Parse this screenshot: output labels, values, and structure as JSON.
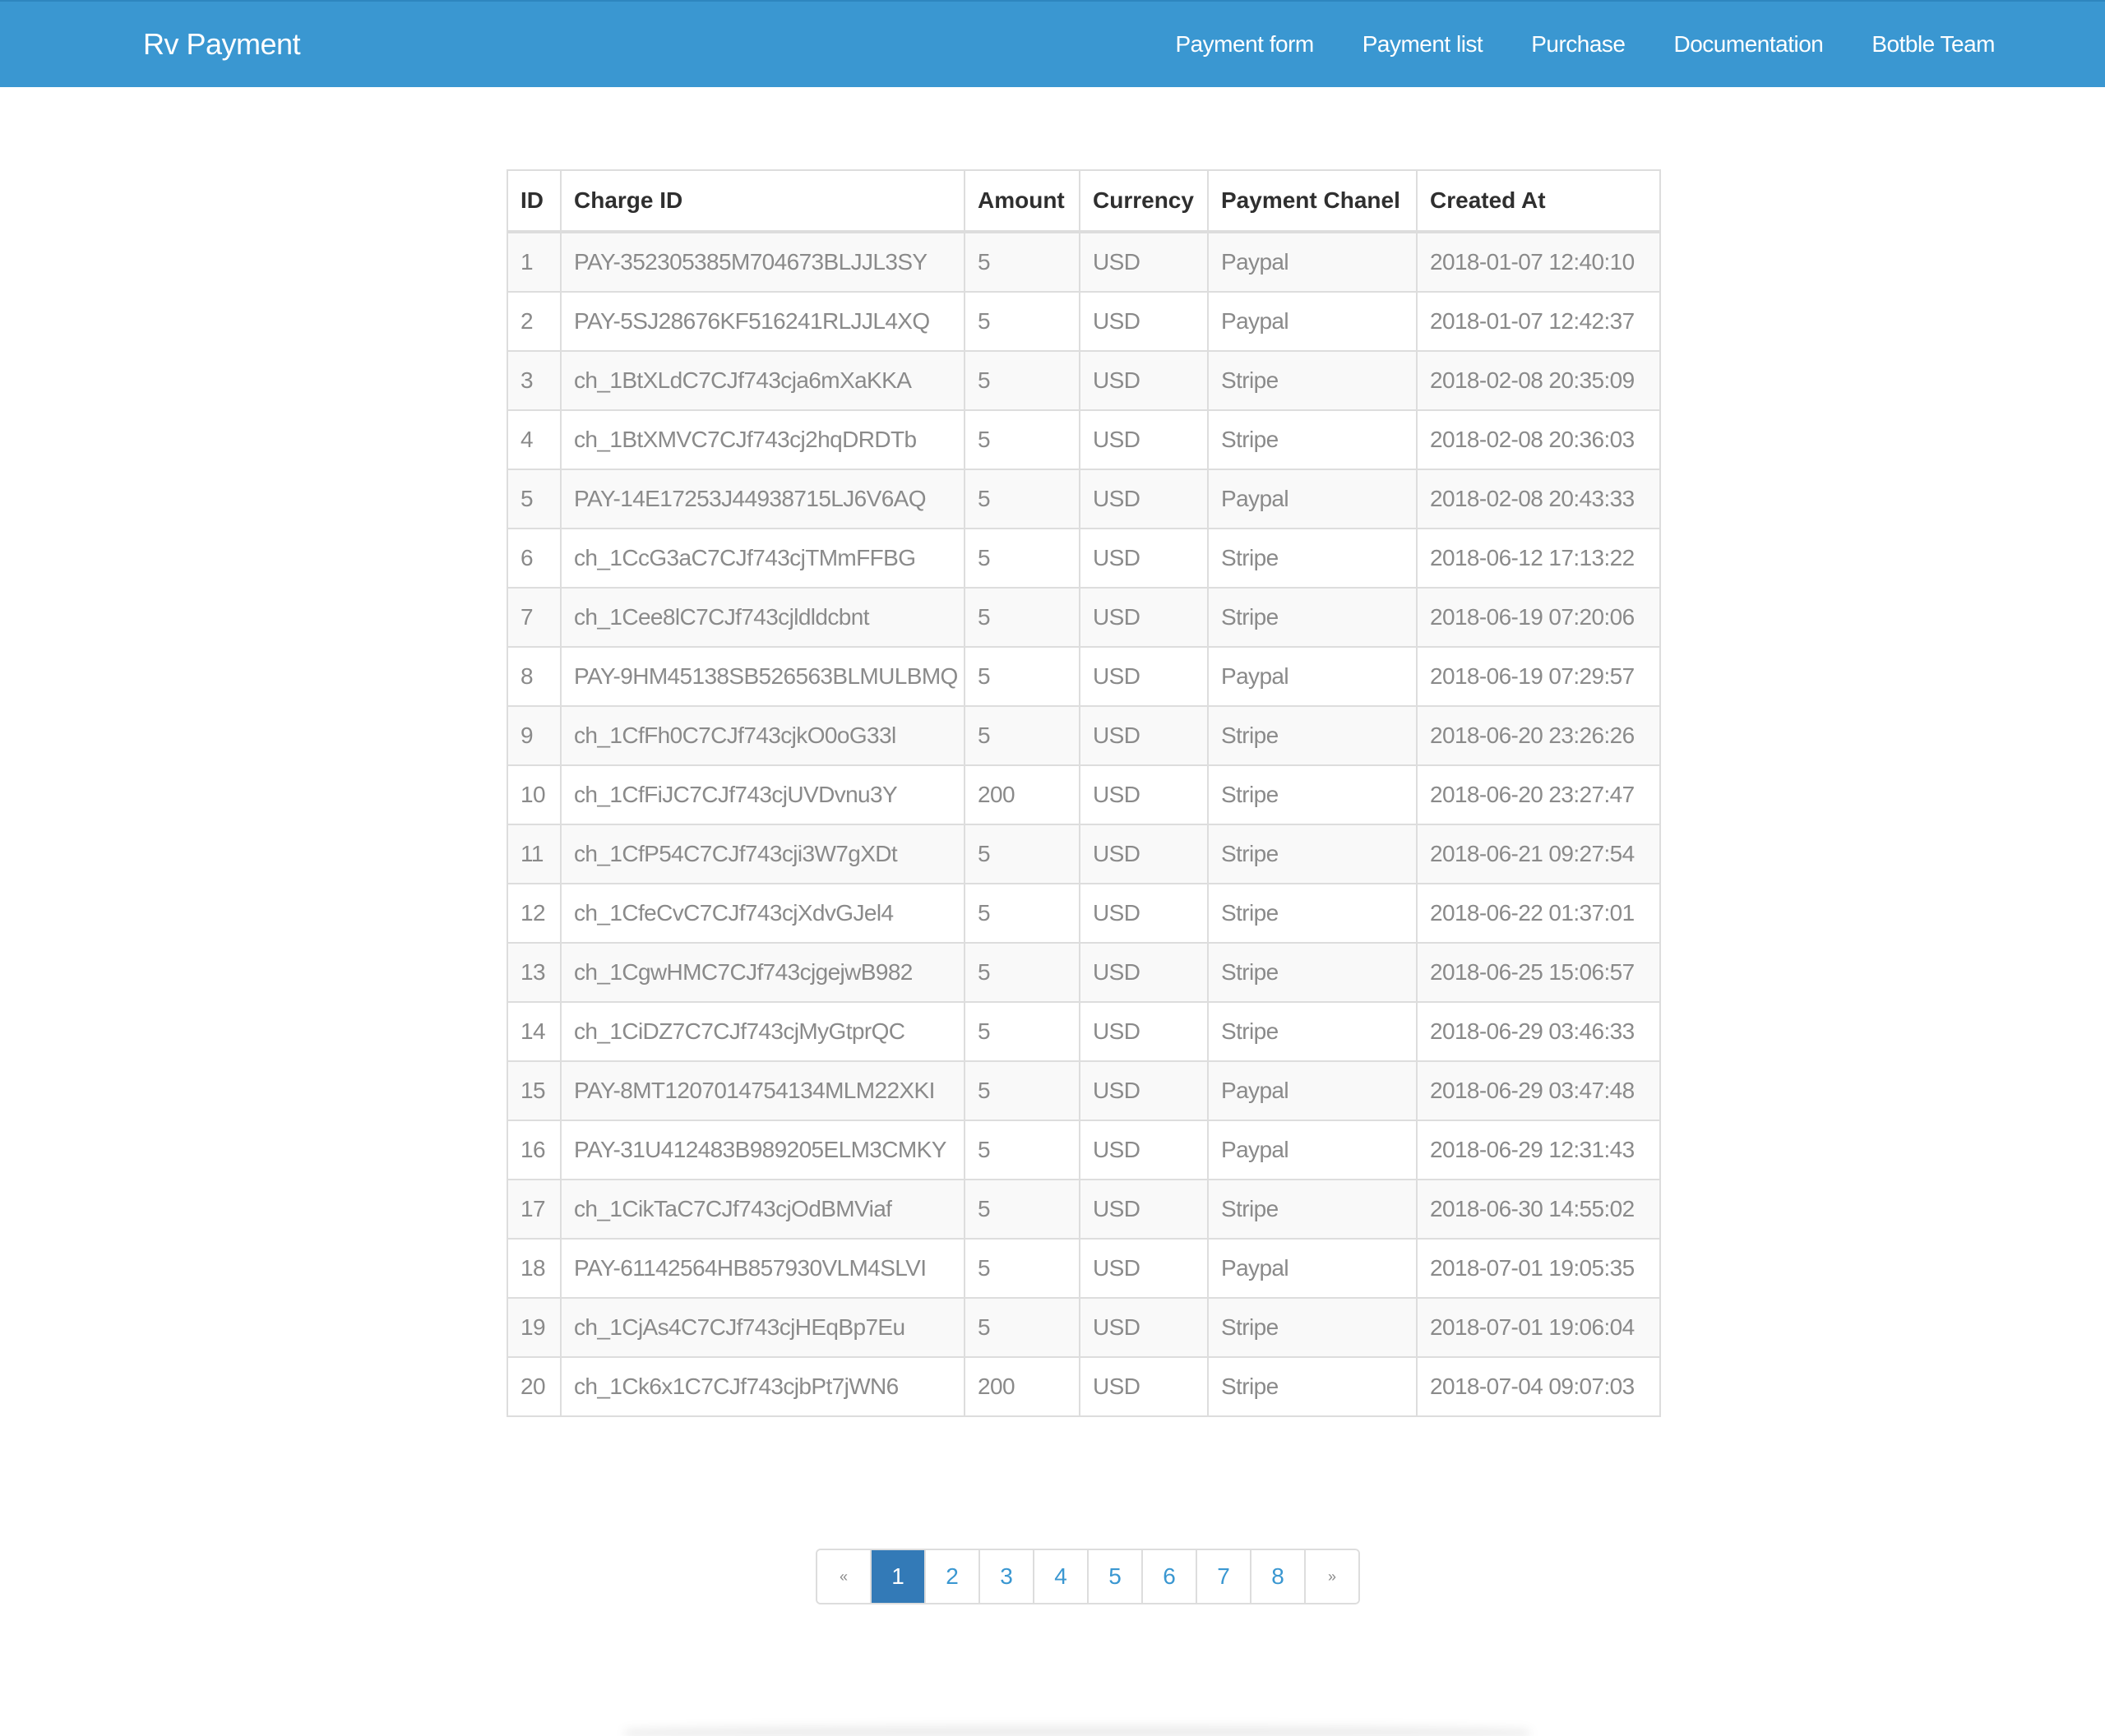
{
  "navbar": {
    "brand": "Rv Payment",
    "items": [
      "Payment form",
      "Payment list",
      "Purchase",
      "Documentation",
      "Botble Team"
    ],
    "color": "#3a97d1"
  },
  "table": {
    "headers": [
      "ID",
      "Charge ID",
      "Amount",
      "Currency",
      "Payment Chanel",
      "Created At"
    ],
    "rows": [
      [
        "1",
        "PAY-352305385M704673BLJJL3SY",
        "5",
        "USD",
        "Paypal",
        "2018-01-07 12:40:10"
      ],
      [
        "2",
        "PAY-5SJ28676KF516241RLJJL4XQ",
        "5",
        "USD",
        "Paypal",
        "2018-01-07 12:42:37"
      ],
      [
        "3",
        "ch_1BtXLdC7CJf743cja6mXaKKA",
        "5",
        "USD",
        "Stripe",
        "2018-02-08 20:35:09"
      ],
      [
        "4",
        "ch_1BtXMVC7CJf743cj2hqDRDTb",
        "5",
        "USD",
        "Stripe",
        "2018-02-08 20:36:03"
      ],
      [
        "5",
        "PAY-14E17253J44938715LJ6V6AQ",
        "5",
        "USD",
        "Paypal",
        "2018-02-08 20:43:33"
      ],
      [
        "6",
        "ch_1CcG3aC7CJf743cjTMmFFBG",
        "5",
        "USD",
        "Stripe",
        "2018-06-12 17:13:22"
      ],
      [
        "7",
        "ch_1Cee8lC7CJf743cjldldcbnt",
        "5",
        "USD",
        "Stripe",
        "2018-06-19 07:20:06"
      ],
      [
        "8",
        "PAY-9HM45138SB526563BLMULBMQ",
        "5",
        "USD",
        "Paypal",
        "2018-06-19 07:29:57"
      ],
      [
        "9",
        "ch_1CfFh0C7CJf743cjkO0oG33l",
        "5",
        "USD",
        "Stripe",
        "2018-06-20 23:26:26"
      ],
      [
        "10",
        "ch_1CfFiJC7CJf743cjUVDvnu3Y",
        "200",
        "USD",
        "Stripe",
        "2018-06-20 23:27:47"
      ],
      [
        "11",
        "ch_1CfP54C7CJf743cji3W7gXDt",
        "5",
        "USD",
        "Stripe",
        "2018-06-21 09:27:54"
      ],
      [
        "12",
        "ch_1CfeCvC7CJf743cjXdvGJel4",
        "5",
        "USD",
        "Stripe",
        "2018-06-22 01:37:01"
      ],
      [
        "13",
        "ch_1CgwHMC7CJf743cjgejwB982",
        "5",
        "USD",
        "Stripe",
        "2018-06-25 15:06:57"
      ],
      [
        "14",
        "ch_1CiDZ7C7CJf743cjMyGtprQC",
        "5",
        "USD",
        "Stripe",
        "2018-06-29 03:46:33"
      ],
      [
        "15",
        "PAY-8MT1207014754134MLM22XKI",
        "5",
        "USD",
        "Paypal",
        "2018-06-29 03:47:48"
      ],
      [
        "16",
        "PAY-31U412483B989205ELM3CMKY",
        "5",
        "USD",
        "Paypal",
        "2018-06-29 12:31:43"
      ],
      [
        "17",
        "ch_1CikTaC7CJf743cjOdBMViaf",
        "5",
        "USD",
        "Stripe",
        "2018-06-30 14:55:02"
      ],
      [
        "18",
        "PAY-61142564HB857930VLM4SLVI",
        "5",
        "USD",
        "Paypal",
        "2018-07-01 19:05:35"
      ],
      [
        "19",
        "ch_1CjAs4C7CJf743cjHEqBp7Eu",
        "5",
        "USD",
        "Stripe",
        "2018-07-01 19:06:04"
      ],
      [
        "20",
        "ch_1Ck6x1C7CJf743cjbPt7jWN6",
        "200",
        "USD",
        "Stripe",
        "2018-07-04 09:07:03"
      ]
    ]
  },
  "pagination": {
    "prev": "«",
    "next": "»",
    "pages": [
      "1",
      "2",
      "3",
      "4",
      "5",
      "6",
      "7",
      "8"
    ],
    "current": "1"
  }
}
